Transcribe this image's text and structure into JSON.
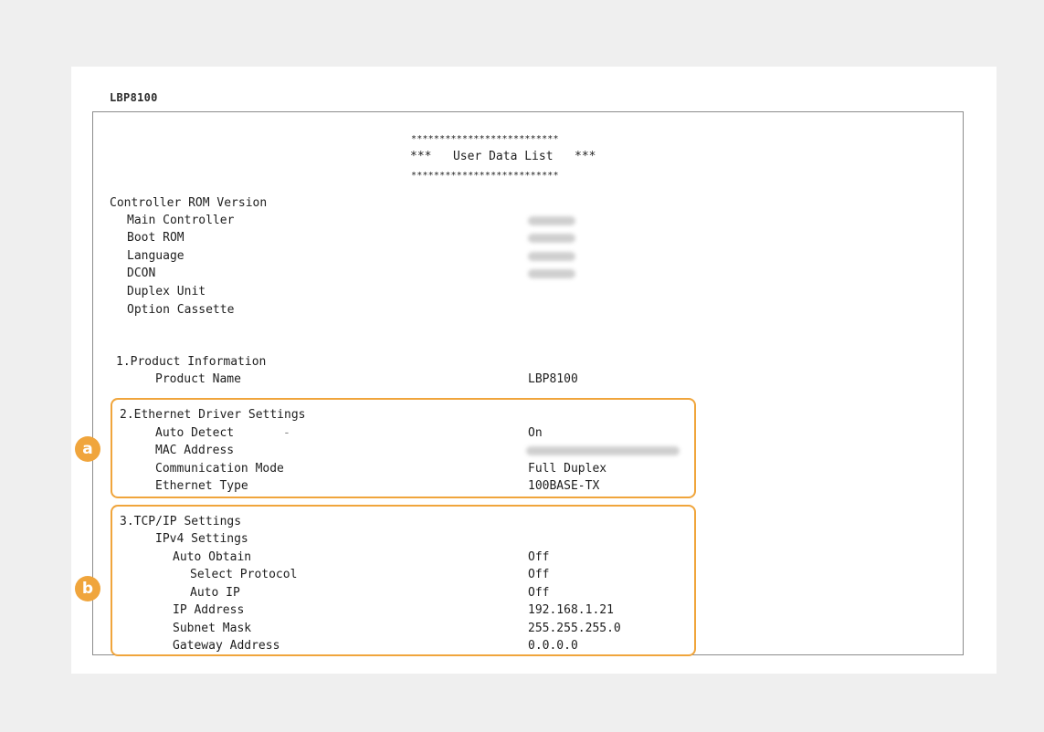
{
  "printer_name": "LBP8100",
  "header": {
    "stars_top": "**************************",
    "title": "***   User Data List   ***",
    "stars_bottom": "**************************"
  },
  "controller": {
    "heading": "Controller ROM Version",
    "items": [
      "Main Controller",
      "Boot ROM",
      "Language",
      "DCON",
      "Duplex Unit",
      "Option Cassette"
    ]
  },
  "product_info": {
    "heading": "1.Product Information",
    "name_label": "Product Name",
    "name_value": "LBP8100"
  },
  "ethernet": {
    "heading": "2.Ethernet Driver Settings",
    "auto_detect_label": "Auto Detect",
    "auto_detect_dash": "-",
    "auto_detect_value": "On",
    "mac_label": "MAC Address",
    "comm_mode_label": "Communication Mode",
    "comm_mode_value": "Full Duplex",
    "eth_type_label": "Ethernet Type",
    "eth_type_value": "100BASE-TX"
  },
  "tcpip": {
    "heading": "3.TCP/IP Settings",
    "ipv4_label": "IPv4 Settings",
    "auto_obtain_label": "Auto Obtain",
    "auto_obtain_value": "Off",
    "select_protocol_label": "Select Protocol",
    "select_protocol_value": "Off",
    "auto_ip_label": "Auto IP",
    "auto_ip_value": "Off",
    "ip_label": "IP Address",
    "ip_value": "192.168.1.21",
    "subnet_label": "Subnet Mask",
    "subnet_value": "255.255.255.0",
    "gateway_label": "Gateway Address",
    "gateway_value": "0.0.0.0"
  },
  "callouts": {
    "a": "a",
    "b": "b"
  },
  "colors": {
    "highlight": "#f0a53c",
    "frame": "#8c8c8c",
    "background": "#efefef"
  }
}
